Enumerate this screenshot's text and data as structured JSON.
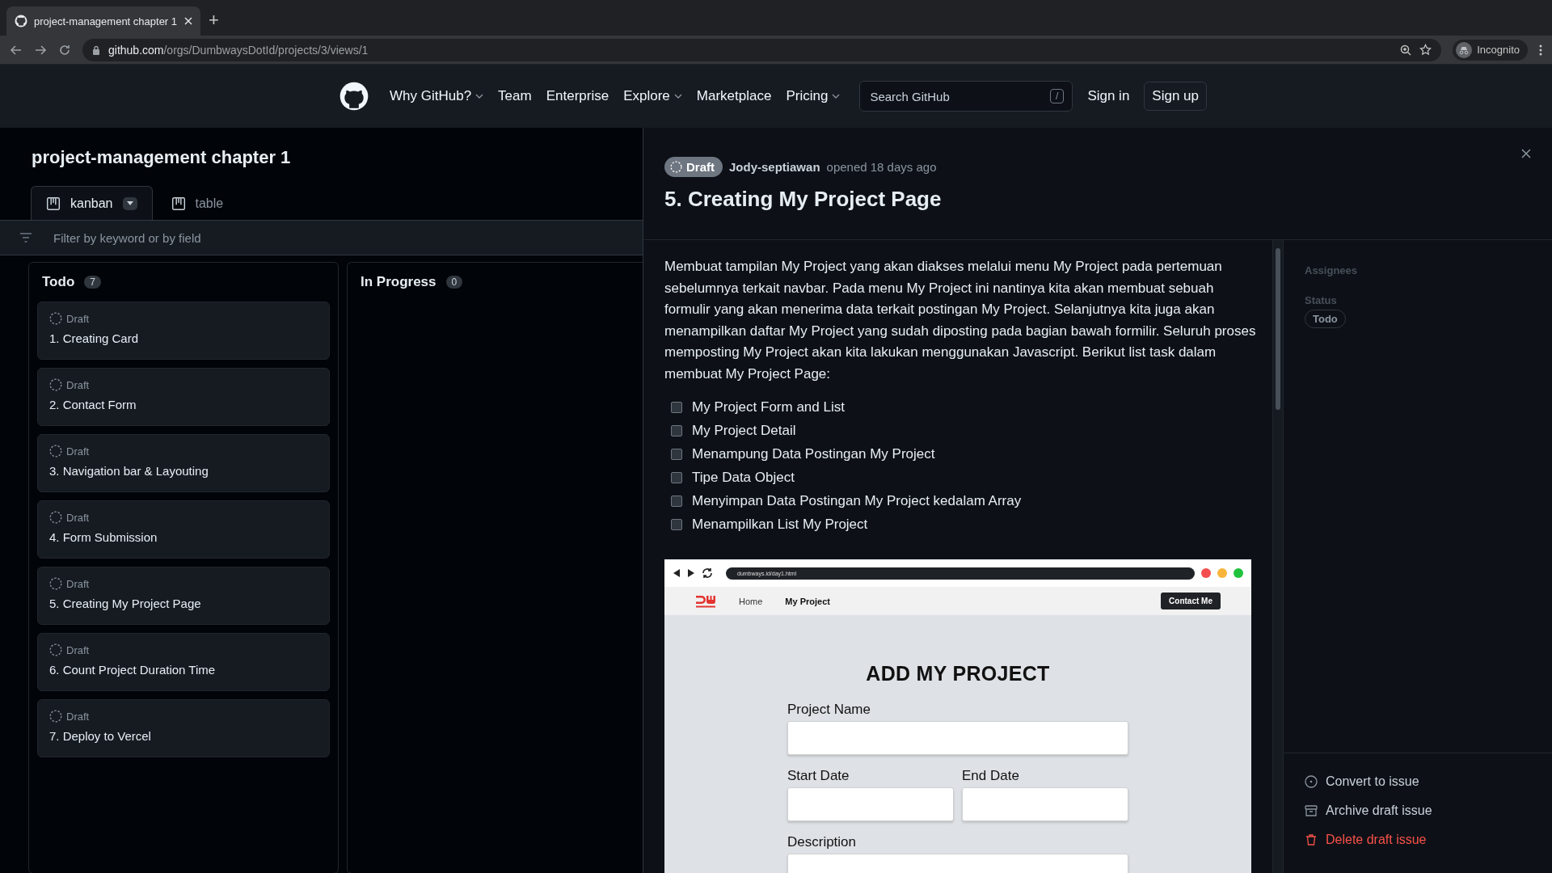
{
  "browser": {
    "tab_title": "project-management chapter 1",
    "new_tab": "+",
    "url_host": "github.com",
    "url_path": "/orgs/DumbwaysDotId/projects/3/views/1",
    "profile": "Incognito"
  },
  "navbar": {
    "items": [
      {
        "label": "Why GitHub?",
        "dropdown": true
      },
      {
        "label": "Team",
        "dropdown": false
      },
      {
        "label": "Enterprise",
        "dropdown": false
      },
      {
        "label": "Explore",
        "dropdown": true
      },
      {
        "label": "Marketplace",
        "dropdown": false
      },
      {
        "label": "Pricing",
        "dropdown": true
      }
    ],
    "search_placeholder": "Search GitHub",
    "search_key": "/",
    "sign_in": "Sign in",
    "sign_up": "Sign up"
  },
  "project": {
    "title": "project-management chapter 1",
    "views": [
      {
        "label": "kanban",
        "selected": true
      },
      {
        "label": "table",
        "selected": false
      }
    ],
    "filter_placeholder": "Filter by keyword or by field",
    "columns": [
      {
        "title": "Todo",
        "count": "7",
        "cards": [
          {
            "status": "Draft",
            "title": "1. Creating Card"
          },
          {
            "status": "Draft",
            "title": "2. Contact Form"
          },
          {
            "status": "Draft",
            "title": "3. Navigation bar & Layouting"
          },
          {
            "status": "Draft",
            "title": "4. Form Submission"
          },
          {
            "status": "Draft",
            "title": "5. Creating My Project Page"
          },
          {
            "status": "Draft",
            "title": "6. Count Project Duration Time"
          },
          {
            "status": "Draft",
            "title": "7. Deploy to Vercel"
          }
        ]
      },
      {
        "title": "In Progress",
        "count": "0"
      }
    ]
  },
  "issue": {
    "badge": "Draft",
    "author": "Jody-septiawan",
    "opened": "opened 18 days ago",
    "title": "5. Creating My Project Page",
    "description": "Membuat tampilan My Project yang akan diakses melalui menu My Project pada pertemuan sebelumnya terkait navbar. Pada menu My Project ini nantinya kita akan membuat sebuah formulir yang akan menerima data terkait postingan My Project. Selanjutnya kita juga akan menampilkan daftar My Project yang sudah diposting pada bagian bawah formilir. Seluruh proses memposting My Project akan kita lakukan menggunakan Javascript. Berikut list task dalam membuat My Project Page:",
    "tasks": [
      {
        "label": "My Project Form and List",
        "checked": false
      },
      {
        "label": "My Project Detail",
        "checked": false
      },
      {
        "label": "Menampung Data Postingan My Project",
        "checked": false
      },
      {
        "label": "Tipe Data Object",
        "checked": false
      },
      {
        "label": "Menyimpan Data Postingan My Project kedalam Array",
        "checked": false
      },
      {
        "label": "Menampilkan List My Project",
        "checked": false
      }
    ],
    "image": {
      "url": "dumbways.id/day1.html",
      "nav": [
        {
          "label": "Home",
          "selected": false
        },
        {
          "label": "My Project",
          "selected": true
        }
      ],
      "contact": "Contact Me",
      "heading": "ADD MY PROJECT",
      "fields": [
        {
          "label": "Project Name",
          "kind": "full"
        },
        {
          "label": "Start Date",
          "kind": "half"
        },
        {
          "label": "End Date",
          "kind": "half"
        },
        {
          "label": "Description",
          "kind": "full"
        }
      ]
    },
    "sidebar": {
      "assignees": "Assignees",
      "status_label": "Status",
      "status": "Todo"
    },
    "actions": [
      {
        "label": "Convert to issue",
        "kind": "convert"
      },
      {
        "label": "Archive draft issue",
        "kind": "archive"
      },
      {
        "label": "Delete draft issue",
        "kind": "delete"
      }
    ]
  }
}
